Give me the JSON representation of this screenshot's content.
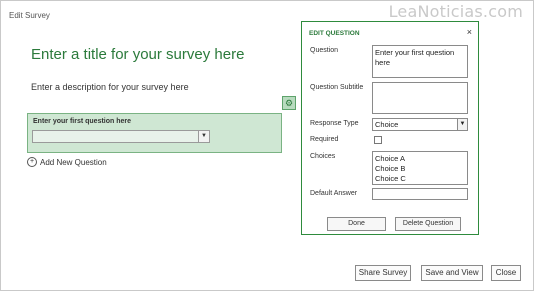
{
  "window": {
    "title": "Edit Survey",
    "watermark": "LeaNoticias.com"
  },
  "survey": {
    "title": "Enter a title for your survey here",
    "description": "Enter a description for your survey here",
    "question_label": "Enter your first question here",
    "add_question": "Add New Question"
  },
  "edit_question": {
    "header": "EDIT QUESTION",
    "close": "×",
    "question_label": "Question",
    "question_value": "Enter your first question here",
    "subtitle_label": "Question Subtitle",
    "subtitle_value": "",
    "response_type_label": "Response Type",
    "response_type_value": "Choice",
    "required_label": "Required",
    "required_checked": false,
    "choices_label": "Choices",
    "choices": [
      "Choice A",
      "Choice B",
      "Choice C"
    ],
    "default_answer_label": "Default Answer",
    "default_answer_value": "",
    "done": "Done",
    "delete_question": "Delete Question"
  },
  "footer": {
    "share_survey": "Share Survey",
    "save_and_view": "Save and View",
    "close": "Close"
  }
}
